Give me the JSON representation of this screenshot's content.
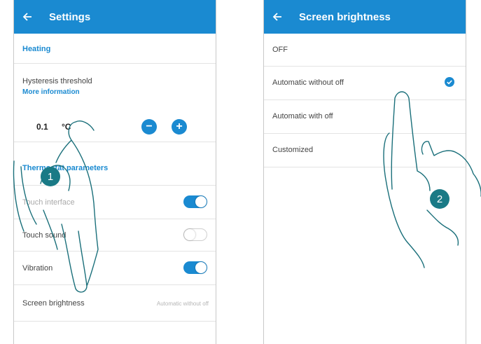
{
  "left": {
    "appbar": {
      "title": "Settings"
    },
    "heating": {
      "title": "Heating"
    },
    "hysteresis": {
      "label": "Hysteresis threshold",
      "link": "More information",
      "value": "0.1",
      "unit": "°C",
      "minus": "−",
      "plus": "+"
    },
    "thermostat": {
      "title": "Thermostat parameters"
    },
    "touch_interface": {
      "label": "Touch interface",
      "state": "on"
    },
    "touch_sound": {
      "label": "Touch sound",
      "state": "off"
    },
    "vibration": {
      "label": "Vibration",
      "state": "on"
    },
    "screen_brightness": {
      "label": "Screen brightness",
      "value": "Automatic without off"
    },
    "badge": "1"
  },
  "right": {
    "appbar": {
      "title": "Screen brightness"
    },
    "options": [
      {
        "label": "OFF"
      },
      {
        "label": "Automatic without off",
        "selected": true
      },
      {
        "label": "Automatic with off"
      },
      {
        "label": "Customized"
      }
    ],
    "badge": "2"
  },
  "colors": {
    "accent": "#1a8ad1",
    "badge": "#1a7a86",
    "line_art": "#1a6f7a"
  }
}
